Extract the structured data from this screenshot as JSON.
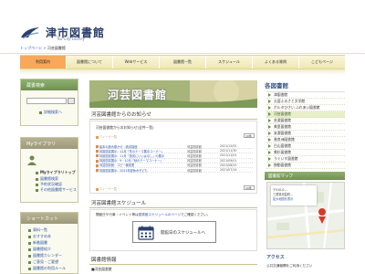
{
  "header": {
    "title": "津市図書館",
    "subtitle": "Tsu City Library",
    "breadcrumb": [
      "トップページ",
      "河芸図書館"
    ],
    "breadcrumb_sep": ">"
  },
  "nav": {
    "items": [
      {
        "label": "利用案内",
        "active": true
      },
      {
        "label": "図書館について",
        "active": false
      },
      {
        "label": "Webサービス",
        "active": false
      },
      {
        "label": "図書館一覧",
        "active": false
      },
      {
        "label": "スケジュール",
        "active": false
      },
      {
        "label": "よくある質問",
        "active": false
      },
      {
        "label": "こどもページ",
        "active": false
      }
    ]
  },
  "left": {
    "search": {
      "title": "蔵書検索",
      "go_label": "",
      "advanced": "詳細検索へ"
    },
    "mylib": {
      "title": "Myライブラリ",
      "links": [
        "Myライブラリトップ",
        "図書館検索",
        "予約状況確認",
        "その他図書館サービス"
      ]
    },
    "shortcut": {
      "title": "ショートカット",
      "links": [
        "資料一覧",
        "おすすめ本",
        "新着図書",
        "図書館紹介",
        "図書館カレンダー",
        "ご意見・ご要望",
        "図書館の利用ルール"
      ]
    }
  },
  "main": {
    "banner_text": "河芸図書館",
    "news": {
      "title": "河芸図書館からのお知らせ",
      "all_label": "河芸図書館からのお知らせ(全件一覧)",
      "feed_label": "フィード一覧",
      "count_label": "10件",
      "rows": [
        {
          "title": "絵本の読み聞かせ・読書講座",
          "section": "河芸図書館",
          "date": "2021/12/02"
        },
        {
          "title": "特設図書展示：12月「冬のテーマ展示コーナー」",
          "section": "河芸図書館",
          "date": "2021/11/30"
        },
        {
          "title": "特設図書展示：11月「読書にいいはなし」の展示",
          "section": "河芸図書館",
          "date": "2021/11/01"
        },
        {
          "title": "特設図書展示：9・10月「秋のテーマコーナー」",
          "section": "河芸図書館",
          "date": "2021/09/01"
        },
        {
          "title": "河芸図書館：コピー機変更",
          "section": "河芸図書館",
          "date": "2021/08/23"
        },
        {
          "title": "特設図書展示：2021年夏休み子ども",
          "section": "河芸図書館",
          "date": "2021/07/14"
        }
      ]
    },
    "schedule": {
      "title": "河芸図書館スケジュール",
      "note_prefix": "開館日や行事・イベント等は",
      "note_link": "図書館スケジュールのページ",
      "note_suffix": "でご確認ください。",
      "button_label": "開館日のスケジュールへ"
    },
    "info": {
      "title": "図書館情報",
      "text": "■河芸図書館"
    }
  },
  "right": {
    "title": "各図書館",
    "libraries": [
      {
        "label": "津図書館",
        "active": false
      },
      {
        "label": "久居ふるさと文学館",
        "active": false
      },
      {
        "label": "ポルタひさい ふれあい図書館",
        "active": false
      },
      {
        "label": "河芸図書館",
        "active": true
      },
      {
        "label": "芸濃図書館",
        "active": false
      },
      {
        "label": "美里図書館",
        "active": false
      },
      {
        "label": "安濃図書館",
        "active": false
      },
      {
        "label": "香良洲図書館",
        "active": false
      },
      {
        "label": "白山図書館",
        "active": false
      },
      {
        "label": "美杉図書館",
        "active": false
      },
      {
        "label": "うぐいす図書館",
        "active": false
      },
      {
        "label": "移動図書館",
        "active": false
      }
    ],
    "map": {
      "title": "図書館マップ",
      "popup_line1": "〒510-0...",
      "popup_line2": "三重県河芸町...",
      "popup_link": "拡大地図を表示"
    },
    "access": {
      "title": "アクセス",
      "text": "公共交通機関をご利用ください"
    }
  },
  "colors": {
    "nav_active": "#f7a85a",
    "box_title_green": "#6f9050",
    "link_blue": "#2a55aa"
  }
}
